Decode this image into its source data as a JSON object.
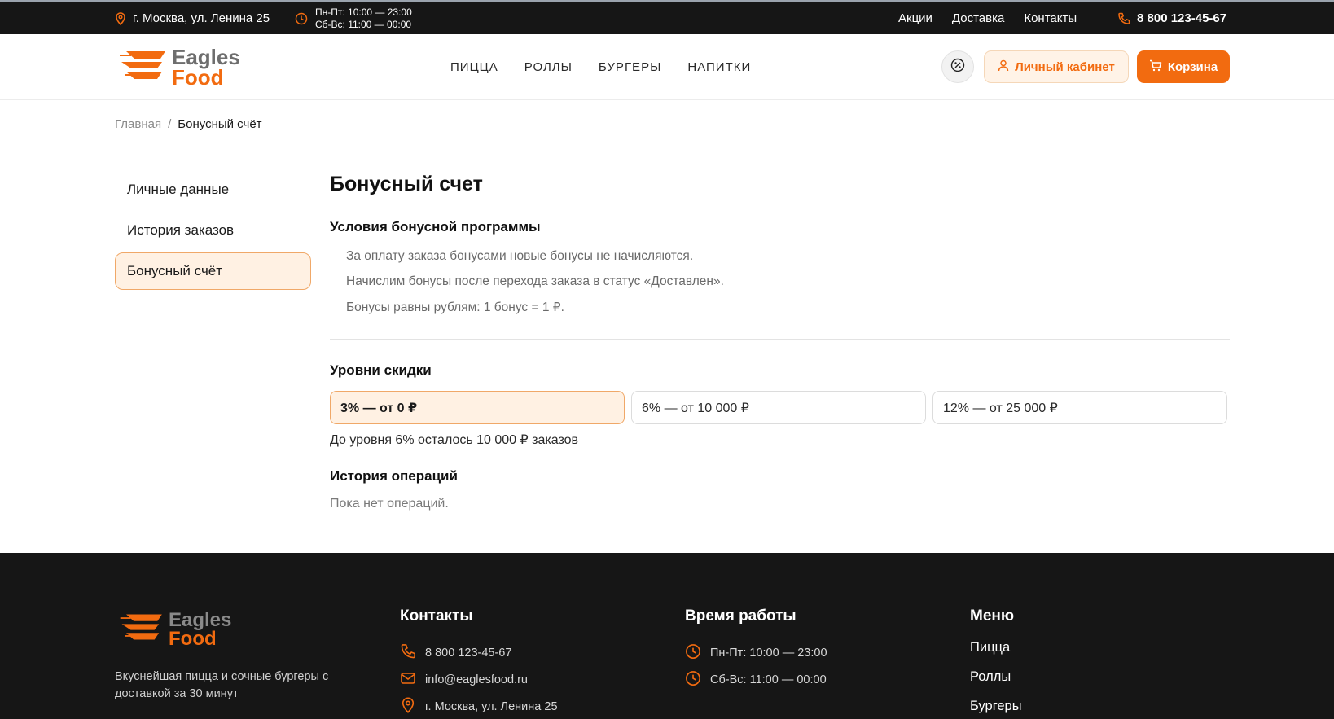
{
  "topbar": {
    "address": "г. Москва, ул. Ленина 25",
    "hours_weekdays": "Пн-Пт: 10:00 — 23:00",
    "hours_weekend": "Сб-Вс: 11:00 — 00:00",
    "nav": [
      "Акции",
      "Доставка",
      "Контакты"
    ],
    "phone": "8 800 123-45-67"
  },
  "header": {
    "logo_line1": "Eagles",
    "logo_line2": "Food",
    "nav": [
      "ПИЦЦА",
      "РОЛЛЫ",
      "БУРГЕРЫ",
      "НАПИТКИ"
    ],
    "cabinet_label": "Личный кабинет",
    "cart_label": "Корзина"
  },
  "breadcrumb": {
    "home": "Главная",
    "separator": "/",
    "current": "Бонусный счёт"
  },
  "sidebar": {
    "items": [
      {
        "label": "Личные данные"
      },
      {
        "label": "История заказов"
      },
      {
        "label": "Бонусный счёт"
      }
    ]
  },
  "content": {
    "title": "Бонусный счет",
    "conditions_title": "Условия бонусной программы",
    "conditions": [
      "За оплату заказа бонусами новые бонусы не начисляются.",
      "Начислим бонусы после перехода заказа в статус «Доставлен».",
      "Бонусы равны рублям: 1 бонус = 1 ₽."
    ],
    "levels_title": "Уровни скидки",
    "levels": [
      {
        "label": "3% — от 0 ₽"
      },
      {
        "label": "6% — от 10 000 ₽"
      },
      {
        "label": "12% — от 25 000 ₽"
      }
    ],
    "progress_note": "До уровня 6% осталось 10 000 ₽ заказов",
    "history_title": "История операций",
    "history_empty": "Пока нет операций."
  },
  "footer": {
    "logo_line1": "Eagles",
    "logo_line2": "Food",
    "description": "Вкуснейшая пицца и сочные бургеры с доставкой за 30 минут",
    "contacts_title": "Контакты",
    "phone": "8 800 123-45-67",
    "email": "info@eaglesfood.ru",
    "address": "г. Москва, ул. Ленина 25",
    "hours_title": "Время работы",
    "hours_weekdays": "Пн-Пт: 10:00 — 23:00",
    "hours_weekend": "Сб-Вс: 11:00 — 00:00",
    "menu_title": "Меню",
    "menu": [
      "Пицца",
      "Роллы",
      "Бургеры"
    ]
  },
  "colors": {
    "accent": "#f26b10",
    "accent_light": "#fff1e3",
    "dark": "#161616"
  },
  "icons": [
    "location-icon",
    "clock-icon",
    "phone-icon",
    "percent-icon",
    "user-icon",
    "cart-icon",
    "mail-icon",
    "logo-icon"
  ]
}
